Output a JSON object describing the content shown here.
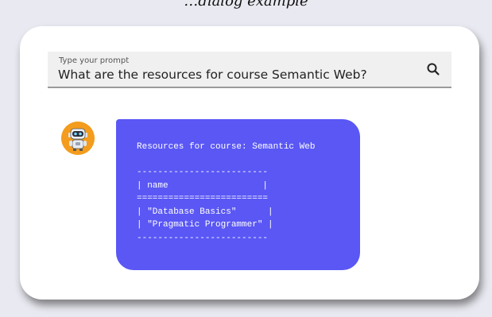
{
  "header": {
    "caption": "…dialog example"
  },
  "search": {
    "label": "Type your prompt",
    "value": "What are the resources for course Semantic Web?",
    "icon": "search-icon"
  },
  "chat": {
    "avatar_icon": "robot-icon",
    "bubble_color": "#5a57f5",
    "response_title": "Resources for course: Semantic Web",
    "table_text": "-------------------------\n| name                  |\n=========================\n| \"Database Basics\"      |\n| \"Pragmatic Programmer\" |\n-------------------------"
  },
  "colors": {
    "background": "#e9e9f1",
    "avatar": "#f39c1d",
    "card": "#ffffff"
  }
}
